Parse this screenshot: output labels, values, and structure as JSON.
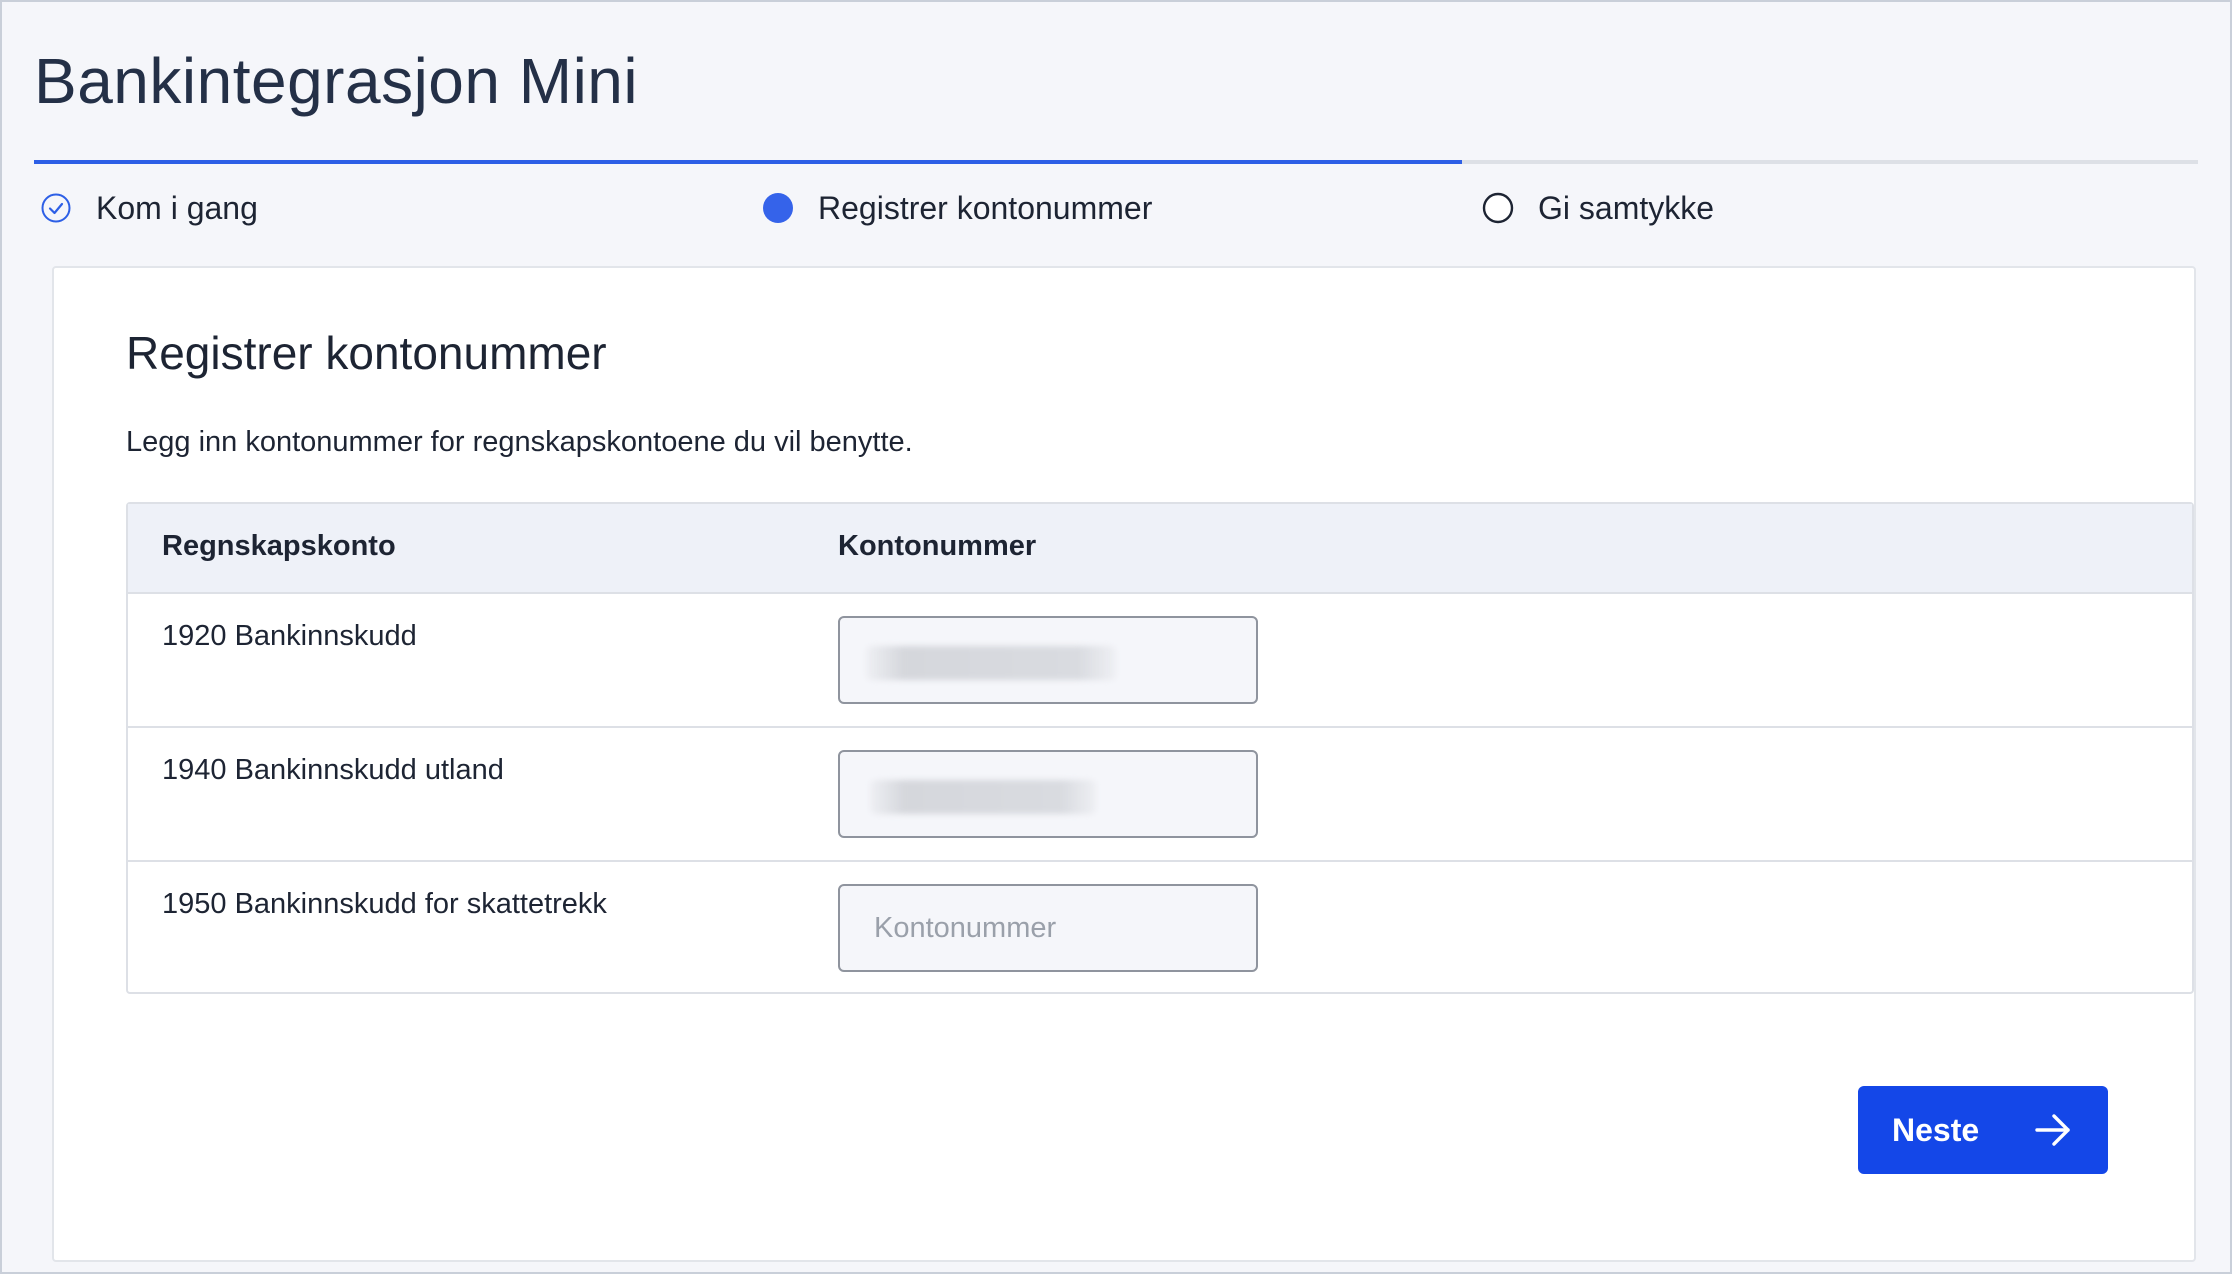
{
  "app": {
    "title": "Bankintegrasjon Mini"
  },
  "stepper": {
    "progress_fraction": 0.66,
    "steps": [
      {
        "label": "Kom i gang",
        "state": "completed",
        "icon": "check-circle-icon"
      },
      {
        "label": "Registrer kontonummer",
        "state": "active",
        "icon": "filled-circle-icon"
      },
      {
        "label": "Gi samtykke",
        "state": "pending",
        "icon": "empty-circle-icon"
      }
    ]
  },
  "card": {
    "title": "Registrer kontonummer",
    "description": "Legg inn kontonummer for regnskapskontoene du vil benytte.",
    "table": {
      "headers": {
        "account": "Regnskapskonto",
        "number": "Kontonummer"
      },
      "rows": [
        {
          "account": "1920 Bankinnskudd",
          "value": "",
          "placeholder": "",
          "redacted": true
        },
        {
          "account": "1940 Bankinnskudd utland",
          "value": "",
          "placeholder": "",
          "redacted": true
        },
        {
          "account": "1950 Bankinnskudd for skattetrekk",
          "value": "",
          "placeholder": "Kontonummer",
          "redacted": false
        }
      ]
    },
    "next_button": {
      "label": "Neste",
      "icon": "arrow-right-icon"
    }
  },
  "colors": {
    "accent": "#1447e8",
    "progress": "#2d5fe6",
    "background": "#f5f6fa"
  }
}
